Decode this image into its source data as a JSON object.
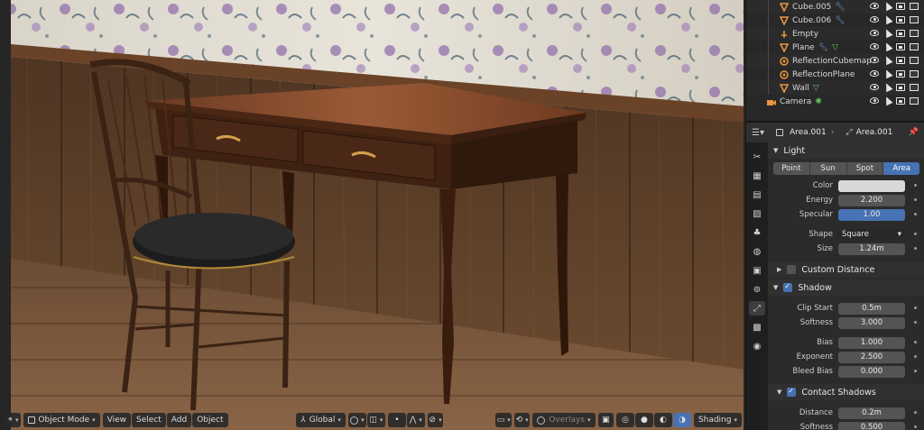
{
  "outliner": {
    "rows": [
      {
        "name": "Cube.005",
        "type": "mesh",
        "color": "#e8953f",
        "extra": "wrench"
      },
      {
        "name": "Cube.006",
        "type": "mesh",
        "color": "#e8953f",
        "extra": "wrench"
      },
      {
        "name": "Empty",
        "type": "empty",
        "color": "#e8953f",
        "extra": ""
      },
      {
        "name": "Plane",
        "type": "mesh",
        "color": "#e8953f",
        "extra": "wrench-tri"
      },
      {
        "name": "ReflectionCubemap",
        "type": "probe",
        "color": "#e8953f",
        "extra": ""
      },
      {
        "name": "ReflectionPlane",
        "type": "probe",
        "color": "#e8953f",
        "extra": ""
      },
      {
        "name": "Wall",
        "type": "mesh",
        "color": "#e8953f",
        "extra": "tri"
      },
      {
        "name": "Camera",
        "type": "camera",
        "color": "#e8953f",
        "extra": "cam-data"
      }
    ]
  },
  "properties": {
    "object_name": "Area.001",
    "data_name": "Area.001",
    "light_panel": "Light",
    "light_types": [
      "Point",
      "Sun",
      "Spot",
      "Area"
    ],
    "active_type": "Area",
    "color_label": "Color",
    "color_value": "#d9d9d9",
    "energy_label": "Energy",
    "energy_value": "2.200",
    "specular_label": "Specular",
    "specular_value": "1.00",
    "shape_label": "Shape",
    "shape_value": "Square",
    "size_label": "Size",
    "size_value": "1.24m",
    "custom_distance_label": "Custom Distance",
    "shadow_label": "Shadow",
    "clip_start_label": "Clip Start",
    "clip_start_value": "0.5m",
    "softness_label": "Softness",
    "softness_value": "3.000",
    "bias_label": "Bias",
    "bias_value": "1.000",
    "exponent_label": "Exponent",
    "exponent_value": "2.500",
    "bleed_bias_label": "Bleed Bias",
    "bleed_bias_value": "0.000",
    "contact_shadows_label": "Contact Shadows",
    "distance_label": "Distance",
    "distance_value": "0.2m",
    "softness2_label": "Softness",
    "softness2_value": "0.500"
  },
  "viewport_header": {
    "mode": "Object Mode",
    "menus": [
      "View",
      "Select",
      "Add",
      "Object"
    ],
    "orientation": "Global",
    "overlays": "Overlays",
    "shading": "Shading"
  },
  "colors": {
    "accent": "#4772b3",
    "object_orange": "#e8953f",
    "modifier_blue": "#6a9fd8",
    "data_green": "#5bc95b"
  }
}
